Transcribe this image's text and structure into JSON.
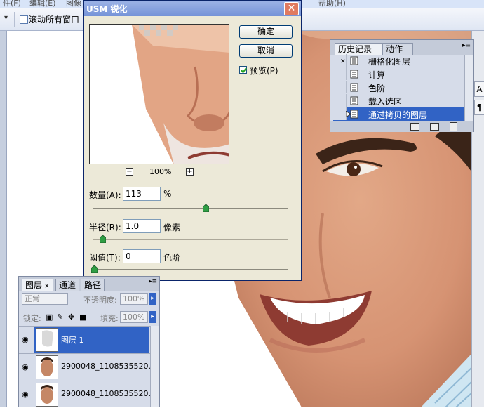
{
  "menubar": {
    "items": [
      "件(F)",
      "编辑(E)",
      "图像",
      "帮助(H)"
    ]
  },
  "options_bar": {
    "dropdown_arrow": "▾",
    "scroll_all_windows_label": "滚动所有窗口",
    "scroll_all_checked": false
  },
  "dialog": {
    "title": "USM 锐化",
    "close_glyph": "✕",
    "ok_label": "确定",
    "cancel_label": "取消",
    "preview_label": "预览(P)",
    "preview_checked": true,
    "zoom_out": "−",
    "zoom_in": "+",
    "zoom_level": "100%",
    "amount": {
      "label": "数量(A):",
      "value": "113",
      "unit": "%",
      "slider_fraction": 0.5
    },
    "radius": {
      "label": "半径(R):",
      "value": "1.0",
      "unit": "像素",
      "slider_fraction": 0.04
    },
    "threshold": {
      "label": "阈值(T):",
      "value": "0",
      "unit": "色阶",
      "slider_fraction": 0.0
    }
  },
  "history_panel": {
    "tabs": [
      "历史记录",
      "动作"
    ],
    "items": [
      {
        "label": "栅格化图层",
        "selected": false
      },
      {
        "label": "计算",
        "selected": false
      },
      {
        "label": "色阶",
        "selected": false
      },
      {
        "label": "载入选区",
        "selected": false
      },
      {
        "label": "通过拷贝的图层",
        "selected": true
      }
    ]
  },
  "layers_panel": {
    "tabs": [
      "图层",
      "通道",
      "路径"
    ],
    "blend_mode": "正常",
    "opacity_label": "不透明度:",
    "opacity_value": "100%",
    "lock_label": "锁定:",
    "fill_label": "填充:",
    "fill_value": "100%",
    "layers": [
      {
        "name": "图层 1",
        "selected": true
      },
      {
        "name": "2900048_1108535520...",
        "selected": false
      },
      {
        "name": "2900048_1108535520...",
        "selected": false
      }
    ]
  },
  "right_tools": [
    "A",
    "¶"
  ],
  "colors": {
    "selection": "#3163c5",
    "title_bar": "#7593d8",
    "panel_bg": "#d6dce9"
  }
}
